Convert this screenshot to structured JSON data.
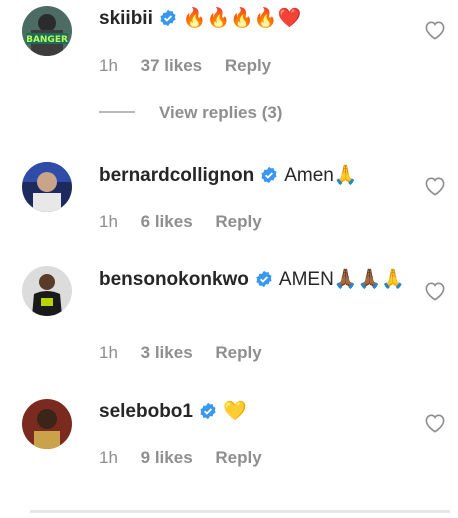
{
  "comments": [
    {
      "username": "skiibii",
      "text": "🔥🔥🔥🔥❤️",
      "time": "1h",
      "likes": "37 likes",
      "reply": "Reply",
      "avatar_text": "BANGER"
    },
    {
      "username": "bernardcollignon",
      "text": "Amen🙏",
      "time": "1h",
      "likes": "6 likes",
      "reply": "Reply"
    },
    {
      "username": "bensonokonkwo",
      "text": "AMEN🙏🏾🙏🏾🙏",
      "time": "1h",
      "likes": "3 likes",
      "reply": "Reply"
    },
    {
      "username": "selebobo1",
      "text": "💛",
      "time": "1h",
      "likes": "9 likes",
      "reply": "Reply"
    }
  ],
  "view_replies": "View replies (3)",
  "colors": {
    "verified": "#3897f0",
    "muted": "#8e8e8e",
    "text": "#262626"
  },
  "icons": {
    "verified": "verified-badge-icon",
    "heart": "heart-outline-icon"
  }
}
